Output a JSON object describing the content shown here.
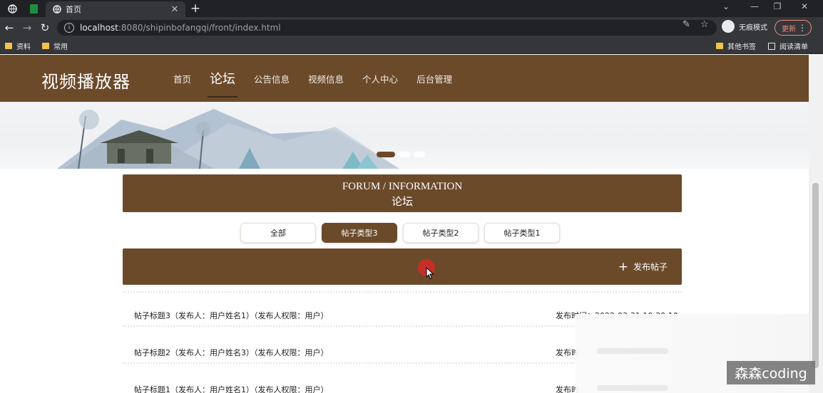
{
  "browser": {
    "tab_title": "首页",
    "new_tab_symbol": "+",
    "close_symbol": "✕",
    "url_host": "localhost",
    "url_rest": ":8080/shipinbofangqi/front/index.html",
    "incognito_label": "无痕模式",
    "update_label": "更新",
    "bookmarks": [
      "资料",
      "常用"
    ],
    "bookmarks_right": [
      "其他书签",
      "阅读清单"
    ]
  },
  "site": {
    "logo": "视频播放器",
    "nav": [
      "首页",
      "论坛",
      "公告信息",
      "视频信息",
      "个人中心",
      "后台管理"
    ],
    "active_nav": "论坛"
  },
  "banner": {
    "slides": 3,
    "active_slide": 1
  },
  "section": {
    "title_en": "FORUM / INFORMATION",
    "title_zh": "论坛"
  },
  "filters": [
    {
      "label": "全部",
      "active": false
    },
    {
      "label": "帖子类型3",
      "active": true
    },
    {
      "label": "帖子类型2",
      "active": false
    },
    {
      "label": "帖子类型1",
      "active": false
    }
  ],
  "post_button": "发布帖子",
  "posts": [
    {
      "title": "帖子标题3（发布人：用户姓名1）（发布人权限：用户）",
      "time": "发布时间：2022-03-31 10:30:10"
    },
    {
      "title": "帖子标题2（发布人：用户姓名3）（发布人权限：用户）",
      "time": "发布时"
    },
    {
      "title": "帖子标题1（发布人：用户姓名1）（发布人权限：用户）",
      "time": "发布时"
    }
  ],
  "watermark": "森森coding",
  "colors": {
    "brand_brown": "#6b4a2a",
    "browser_dark": "#202124",
    "browser_mid": "#35363a"
  }
}
